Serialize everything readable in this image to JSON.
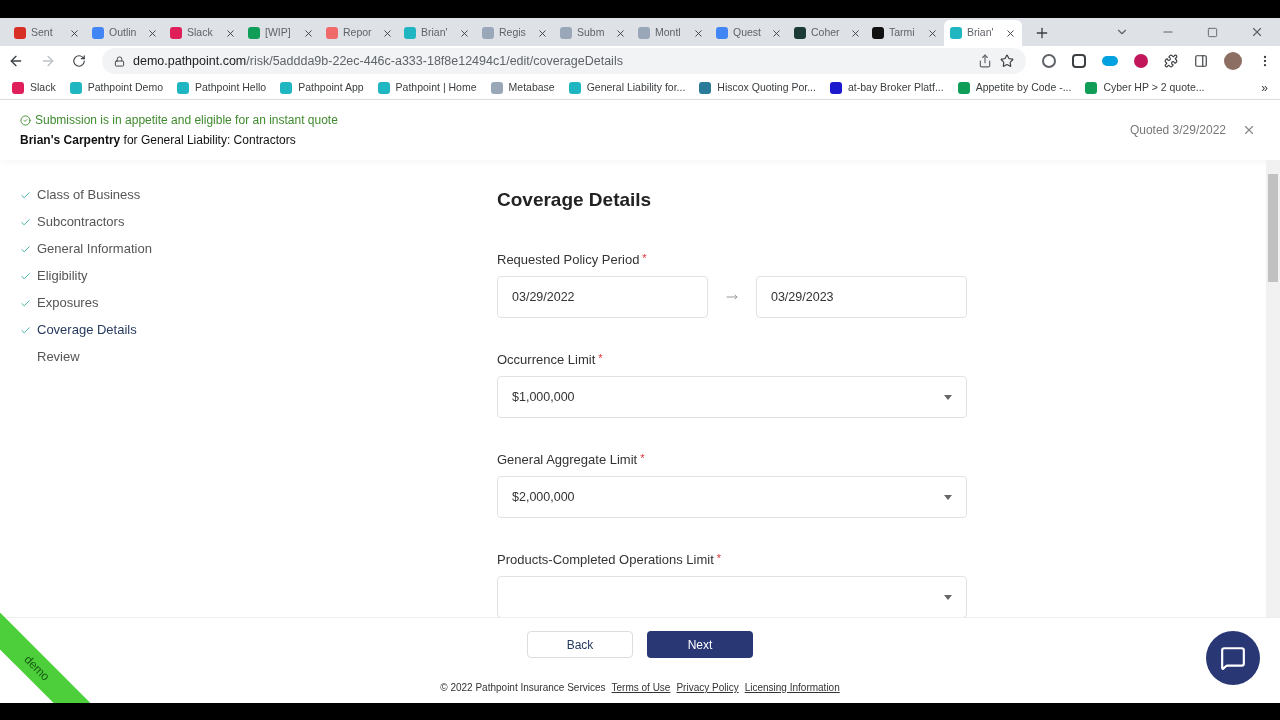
{
  "browser": {
    "tabs": [
      {
        "title": "Sent",
        "selected": false
      },
      {
        "title": "Outlin",
        "selected": false
      },
      {
        "title": "Slack",
        "selected": false
      },
      {
        "title": "[WIP]",
        "selected": false
      },
      {
        "title": "Repor",
        "selected": false
      },
      {
        "title": "Brian'",
        "selected": false
      },
      {
        "title": "Regis",
        "selected": false
      },
      {
        "title": "Subm",
        "selected": false
      },
      {
        "title": "Montl",
        "selected": false
      },
      {
        "title": "Quest",
        "selected": false
      },
      {
        "title": "Coher",
        "selected": false
      },
      {
        "title": "Tarmi",
        "selected": false
      },
      {
        "title": "Brian'",
        "selected": true
      }
    ],
    "url_host": "demo.pathpoint.com",
    "url_path": "/risk/5addda9b-22ec-446c-a333-18f8e12494c1/edit/coverageDetails",
    "bookmarks": [
      "Slack",
      "Pathpoint Demo",
      "Pathpoint Hello",
      "Pathpoint App",
      "Pathpoint | Home",
      "Metabase",
      "General Liability for...",
      "Hiscox Quoting Por...",
      "at-bay Broker Platf...",
      "Appetite by Code -...",
      "Cyber HP > 2 quote..."
    ],
    "more": "»"
  },
  "header": {
    "status": "Submission is in appetite and eligible for an instant quote",
    "business": "Brian's Carpentry",
    "line": "for General Liability: Contractors",
    "quoted": "Quoted 3/29/2022"
  },
  "steps": [
    {
      "label": "Class of Business",
      "completed": true,
      "selected": false
    },
    {
      "label": "Subcontractors",
      "completed": true,
      "selected": false
    },
    {
      "label": "General Information",
      "completed": true,
      "selected": false
    },
    {
      "label": "Eligibility",
      "completed": true,
      "selected": false
    },
    {
      "label": "Exposures",
      "completed": true,
      "selected": false
    },
    {
      "label": "Coverage Details",
      "completed": true,
      "selected": true
    },
    {
      "label": "Review",
      "completed": false,
      "selected": false
    }
  ],
  "form": {
    "title": "Coverage Details",
    "fields": [
      {
        "kind": "date-range",
        "label": "Requested Policy Period",
        "required_mark": "*",
        "values": [
          "03/29/2022",
          "03/29/2023"
        ]
      },
      {
        "kind": "select",
        "label": "Occurrence Limit",
        "required_mark": "*",
        "values": [
          "$1,000,000"
        ]
      },
      {
        "kind": "select",
        "label": "General Aggregate Limit",
        "required_mark": "*",
        "values": [
          "$2,000,000"
        ]
      },
      {
        "kind": "select",
        "label": "Products-Completed Operations Limit",
        "required_mark": "*"
      }
    ]
  },
  "buttons": {
    "back": "Back",
    "next": "Next"
  },
  "footer": {
    "copyright": "© 2022 Pathpoint Insurance Services",
    "links": [
      "Terms of Use",
      "Privacy Policy",
      "Licensing Information"
    ]
  },
  "ribbon": "demo"
}
